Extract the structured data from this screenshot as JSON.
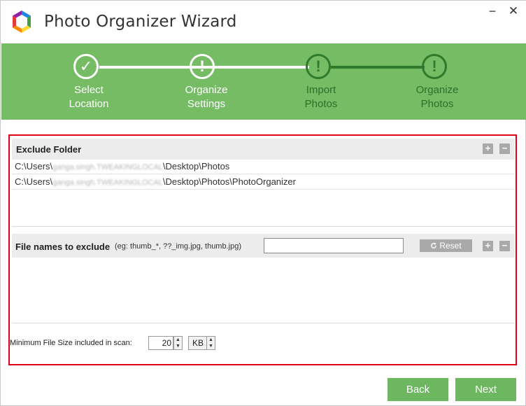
{
  "window": {
    "title": "Photo Organizer Wizard",
    "minimize_glyph": "−",
    "close_glyph": "✕",
    "icon": "photo-organizer-logo-icon"
  },
  "colors": {
    "stepper_bg": "#76bc65",
    "stepper_pending": "#2f7a2b",
    "accent_button": "#6db761",
    "frame_border": "#e3001b"
  },
  "steps": [
    {
      "line1": "Select",
      "line2": "Location",
      "state": "done",
      "glyph": "✓"
    },
    {
      "line1": "Organize",
      "line2": "Settings",
      "state": "active",
      "glyph": "!"
    },
    {
      "line1": "Import",
      "line2": "Photos",
      "state": "pending",
      "glyph": "!"
    },
    {
      "line1": "Organize",
      "line2": "Photos",
      "state": "pending",
      "glyph": "!"
    }
  ],
  "exclude_folder": {
    "title": "Exclude Folder",
    "add_glyph": "+",
    "remove_glyph": "−",
    "paths": [
      {
        "prefix": "C:\\Users\\",
        "masked": "ganga.singh.TWEAKINGLOCAL",
        "suffix": "\\Desktop\\Photos"
      },
      {
        "prefix": "C:\\Users\\",
        "masked": "ganga.singh.TWEAKINGLOCAL",
        "suffix": "\\Desktop\\Photos\\PhotoOrganizer"
      }
    ]
  },
  "file_names": {
    "title": "File names to exclude",
    "hint": "(eg: thumb_*, ??_img.jpg, thumb.jpg)",
    "input_value": "",
    "reset_label": "Reset",
    "reset_icon": "refresh-icon",
    "add_glyph": "+",
    "remove_glyph": "−"
  },
  "min_size": {
    "label": "Minimum File Size included in scan:",
    "value": "20",
    "unit": "KB"
  },
  "footer": {
    "back_label": "Back",
    "next_label": "Next"
  }
}
